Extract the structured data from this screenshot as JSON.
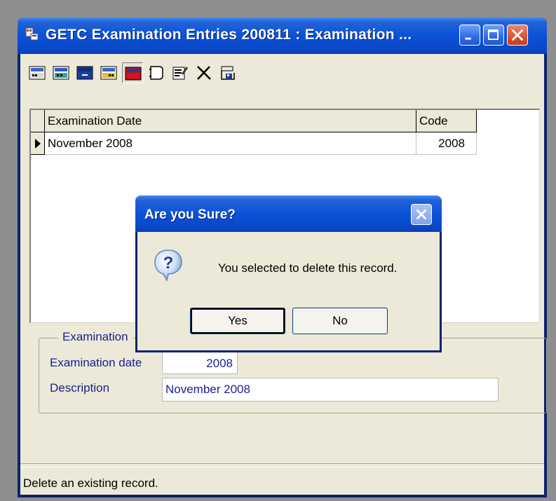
{
  "window": {
    "title": "GETC Examination Entries 200811 : Examination ...",
    "controls": [
      "minimize-icon",
      "maximize-icon",
      "close-icon"
    ]
  },
  "toolbar": {
    "buttons": [
      {
        "name": "first-record",
        "icon": "first-record-icon"
      },
      {
        "name": "previous-record",
        "icon": "previous-record-icon"
      },
      {
        "name": "next-record",
        "icon": "next-record-icon"
      },
      {
        "name": "last-record",
        "icon": "last-record-icon"
      },
      {
        "name": "delete-record",
        "icon": "delete-record-icon",
        "pressed": true
      },
      {
        "name": "new-record",
        "icon": "new-record-icon"
      },
      {
        "name": "edit-record",
        "icon": "edit-record-icon"
      },
      {
        "name": "cancel",
        "icon": "cancel-icon"
      },
      {
        "name": "save",
        "icon": "save-icon"
      }
    ]
  },
  "grid": {
    "columns": [
      "Examination Date",
      "Code"
    ],
    "rows": [
      {
        "examination_date": "November 2008",
        "code": "2008",
        "current": true
      }
    ]
  },
  "form": {
    "group_label": "Examination",
    "date_label": "Examination date",
    "date_value": "2008",
    "description_label": "Description",
    "description_value": "November 2008"
  },
  "status_bar": {
    "text": "Delete an existing record."
  },
  "dialog": {
    "title": "Are you Sure?",
    "message": "You selected to delete this record.",
    "icon": "question-icon",
    "yes_label": "Yes",
    "no_label": "No"
  },
  "colors": {
    "titlebar_blue": "#0b52d8",
    "window_face": "#ece9d8",
    "label_blue": "#1a1f8f",
    "close_red": "#d9532f"
  }
}
